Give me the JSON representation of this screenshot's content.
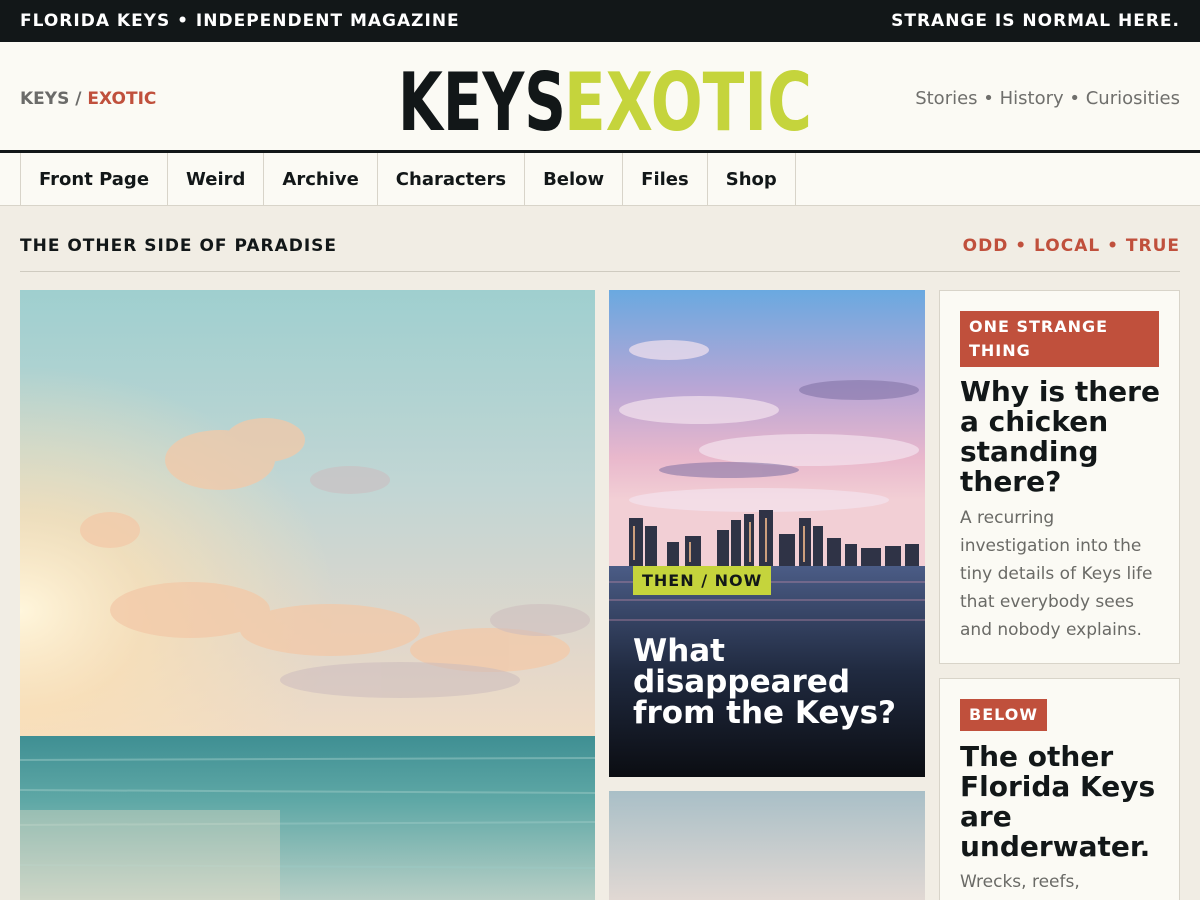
{
  "topbar": {
    "left": "FLORIDA KEYS • INDEPENDENT MAGAZINE",
    "right": "STRANGE IS NORMAL HERE."
  },
  "masthead": {
    "crumb_primary": "KEYS",
    "crumb_separator": "/",
    "crumb_secondary": "EXOTIC",
    "logo_left": "KEYS",
    "logo_right": "EXOTIC",
    "tagline": "Stories • History • Curiosities"
  },
  "nav": {
    "items": [
      "Front Page",
      "Weird",
      "Archive",
      "Characters",
      "Below",
      "Files",
      "Shop"
    ]
  },
  "section": {
    "label": "THE OTHER SIDE OF PARADISE",
    "tags": "ODD • LOCAL • TRUE"
  },
  "feature": {
    "kicker": "THEN / NOW",
    "headline": "What disappeared from the Keys?"
  },
  "cards": [
    {
      "badge": "ONE STRANGE THING",
      "title": "Why is there a chicken standing there?",
      "body": "A recurring investigation into the tiny details of Keys life that everybody sees and nobody explains."
    },
    {
      "badge": "BELOW",
      "title": "The other Florida Keys are underwater.",
      "body": "Wrecks, reefs,"
    }
  ],
  "colors": {
    "ink": "#121718",
    "lime": "#c5d43c",
    "rust": "#c0503c",
    "paper": "#fbfaf4",
    "background": "#f1ede4"
  }
}
